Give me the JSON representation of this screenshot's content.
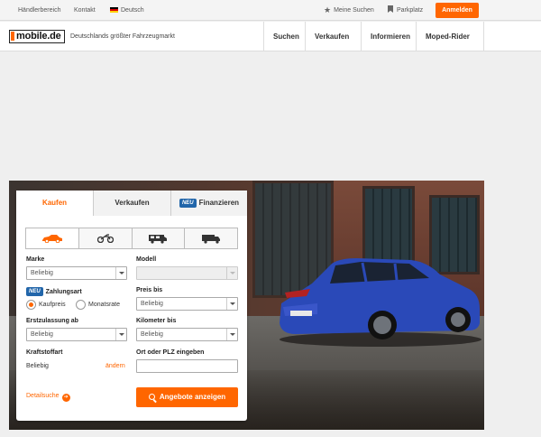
{
  "topbar": {
    "dealer_area": "Händlerbereich",
    "contact": "Kontakt",
    "language": "Deutsch",
    "my_searches": "Meine Suchen",
    "parking": "Parkplatz",
    "login": "Anmelden"
  },
  "header": {
    "logo": "mobile.de",
    "tagline": "Deutschlands größter Fahrzeugmarkt",
    "nav": [
      "Suchen",
      "Verkaufen",
      "Informieren",
      "Moped-Rider"
    ]
  },
  "search": {
    "tabs": {
      "buy": "Kaufen",
      "sell": "Verkaufen",
      "new_badge": "NEU",
      "finance": "Finanzieren"
    },
    "vehicle_types": [
      "car-icon",
      "motorbike-icon",
      "camper-icon",
      "truck-icon"
    ],
    "make_label": "Marke",
    "make_value": "Beliebig",
    "model_label": "Modell",
    "payment_badge": "NEU",
    "payment_label": "Zahlungsart",
    "purchase_price": "Kaufpreis",
    "monthly_rate": "Monatsrate",
    "price_label": "Preis bis",
    "price_value": "Beliebig",
    "registration_label": "Erstzulassung ab",
    "registration_value": "Beliebig",
    "mileage_label": "Kilometer bis",
    "mileage_value": "Beliebig",
    "fuel_label": "Kraftstoffart",
    "fuel_value": "Beliebig",
    "change_link": "ändern",
    "location_label": "Ort oder PLZ eingeben",
    "detail_search": "Detailsuche",
    "submit": "Angebote anzeigen"
  },
  "colors": {
    "accent": "#ff6600",
    "badge": "#2266aa"
  }
}
